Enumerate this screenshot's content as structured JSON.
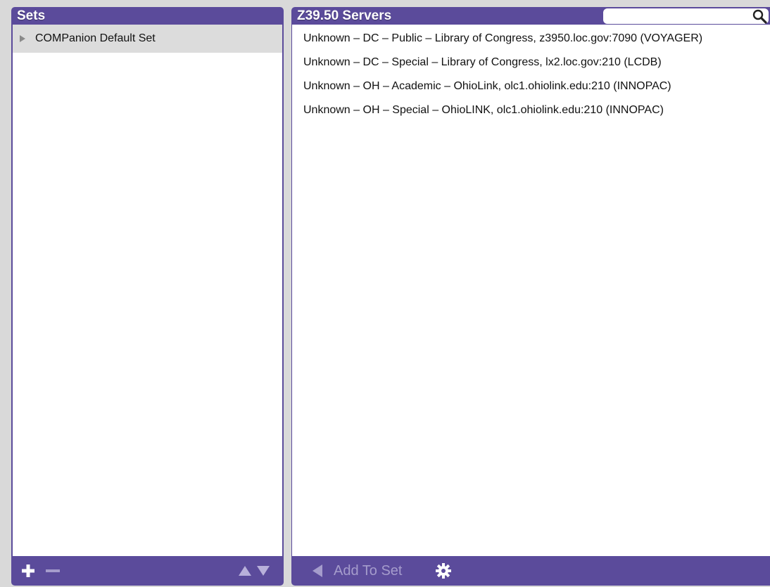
{
  "sets_panel": {
    "title": "Sets",
    "items": [
      {
        "label": "COMPanion Default Set"
      }
    ],
    "footer": {
      "add_icon": "plus-icon",
      "remove_icon": "minus-icon",
      "move_up_icon": "triangle-up-icon",
      "move_down_icon": "triangle-down-icon"
    }
  },
  "servers_panel": {
    "title": "Z39.50 Servers",
    "search": {
      "value": "",
      "placeholder": "",
      "icon": "search-icon"
    },
    "servers": [
      {
        "label": "Unknown – DC – Public – Library of Congress, z3950.loc.gov:7090 (VOYAGER)"
      },
      {
        "label": "Unknown – DC – Special – Library of Congress, lx2.loc.gov:210 (LCDB)"
      },
      {
        "label": "Unknown – OH – Academic – OhioLink, olc1.ohiolink.edu:210 (INNOPAC)"
      },
      {
        "label": "Unknown – OH – Special – OhioLINK, olc1.ohiolink.edu:210 (INNOPAC)"
      }
    ],
    "footer": {
      "add_to_set_label": "Add To Set",
      "add_to_set_icon": "arrow-left-icon",
      "settings_icon": "gear-icon"
    }
  },
  "colors": {
    "panel_purple": "#5b4b9b",
    "selected_row": "#dcdcdc",
    "disabled_text": "#a59ccc",
    "window_bg": "#d9d9d9"
  }
}
